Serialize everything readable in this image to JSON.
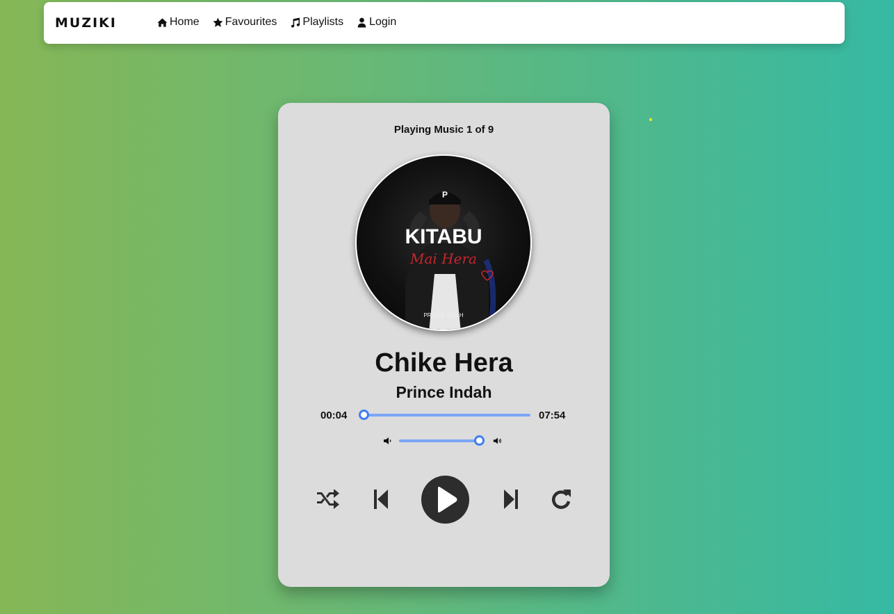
{
  "nav": {
    "brand": "MUZIKI",
    "links": [
      {
        "label": "Home",
        "icon": "home-icon"
      },
      {
        "label": "Favourites",
        "icon": "star-icon"
      },
      {
        "label": "Playlists",
        "icon": "music-icon"
      },
      {
        "label": "Login",
        "icon": "user-icon"
      }
    ]
  },
  "player": {
    "status": "Playing Music 1 of 9",
    "album_art": {
      "title": "KITABU",
      "script_text": "Mai Hera",
      "artist_text": "PRINCE INDAH"
    },
    "song_title": "Chike Hera",
    "artist": "Prince Indah",
    "current_time": "00:04",
    "duration": "07:54",
    "progress_fraction": 0.008,
    "volume_fraction": 1.0,
    "controls": [
      "shuffle-icon",
      "previous-icon",
      "play-icon",
      "next-icon",
      "repeat-icon"
    ]
  },
  "colors": {
    "accent": "#3f7df2",
    "track": "#7aa6f7",
    "card": "#dcdcdc",
    "button": "#2d2d2d"
  }
}
